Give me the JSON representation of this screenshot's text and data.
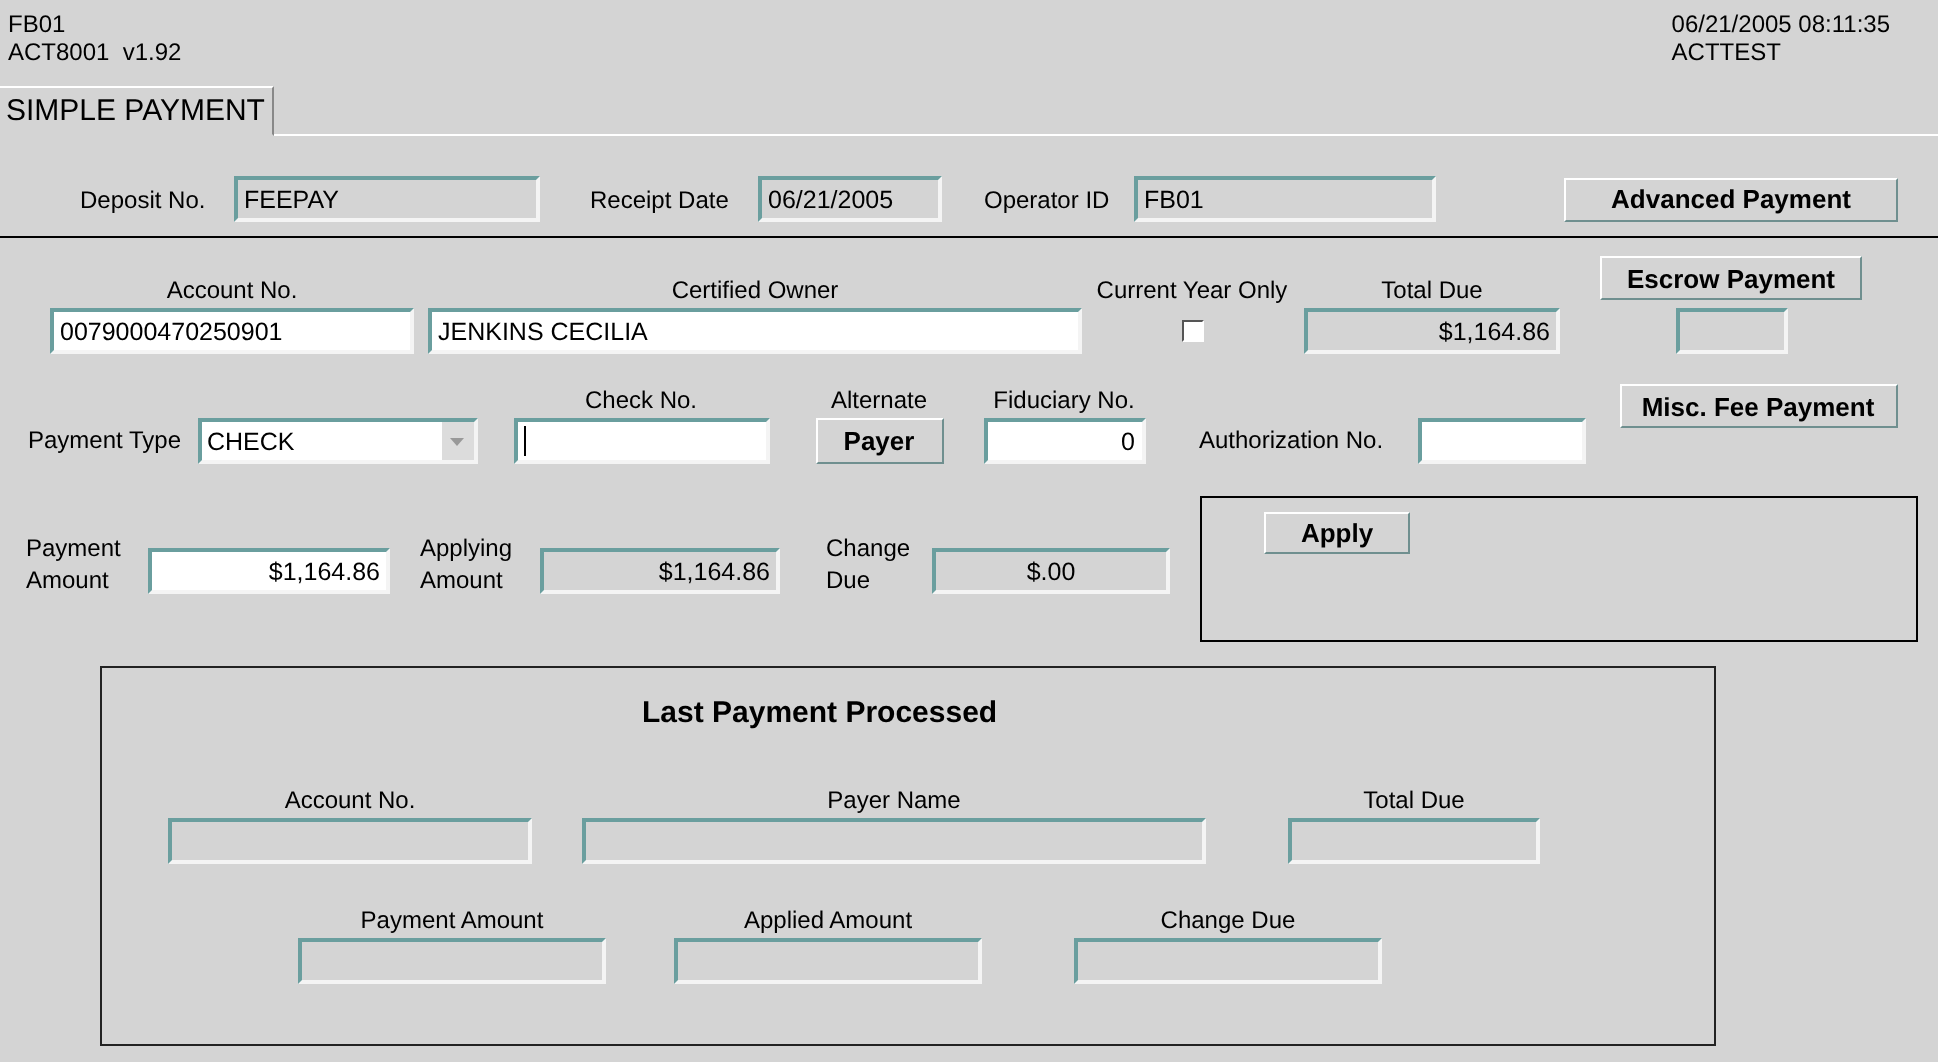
{
  "header": {
    "left": [
      "FB01",
      "ACT8001  v1.92"
    ],
    "right": [
      "06/21/2005 08:11:35",
      "ACTTEST"
    ]
  },
  "tabs": [
    {
      "label": "SIMPLE PAYMENT",
      "selected": true
    }
  ],
  "deposit": {
    "fields": [
      {
        "label": "Deposit No.",
        "value": "FEEPAY",
        "editable": false
      },
      {
        "label": "Receipt Date",
        "value": "06/21/2005",
        "editable": false
      },
      {
        "label": "Operator ID",
        "value": "FB01",
        "editable": false
      }
    ],
    "advanced_button": "Advanced Payment"
  },
  "account": {
    "account_no": {
      "label": "Account No.",
      "value": "0079000470250901",
      "editable": true
    },
    "certified_owner": {
      "label": "Certified Owner",
      "value": "JENKINS CECILIA",
      "editable": true
    },
    "current_year_only": {
      "label": "Current Year Only",
      "checked": false
    },
    "total_due": {
      "label": "Total Due",
      "value": "$1,164.86",
      "editable": false
    },
    "escrow_button": "Escrow Payment",
    "escrow_field": {
      "editable": false
    }
  },
  "payment": {
    "payment_type": {
      "label": "Payment Type",
      "value": "CHECK"
    },
    "check_no": {
      "label": "Check No.",
      "editable": true,
      "focused": true
    },
    "alternate": {
      "label": "Alternate",
      "button": "Payer"
    },
    "fiduciary_no": {
      "label": "Fiduciary No.",
      "value": "0",
      "editable": true
    },
    "authorization_no": {
      "label": "Authorization No.",
      "editable": true
    },
    "misc_fee_button": "Misc. Fee Payment"
  },
  "amounts": {
    "payment_amount": {
      "label": "Payment Amount",
      "value": "$1,164.86",
      "editable": true
    },
    "applying_amount": {
      "label": "Applying Amount",
      "value": "$1,164.86",
      "editable": false
    },
    "change_due": {
      "label": "Change Due",
      "value": "$.00",
      "editable": false
    },
    "apply_button": "Apply"
  },
  "last_payment": {
    "title": "Last Payment Processed",
    "fields": [
      {
        "label": "Account No.",
        "editable": false
      },
      {
        "label": "Payer Name",
        "editable": false
      },
      {
        "label": "Total Due",
        "editable": false
      },
      {
        "label": "Payment Amount",
        "editable": false
      },
      {
        "label": "Applied Amount",
        "editable": false
      },
      {
        "label": "Change Due",
        "editable": false
      }
    ]
  }
}
